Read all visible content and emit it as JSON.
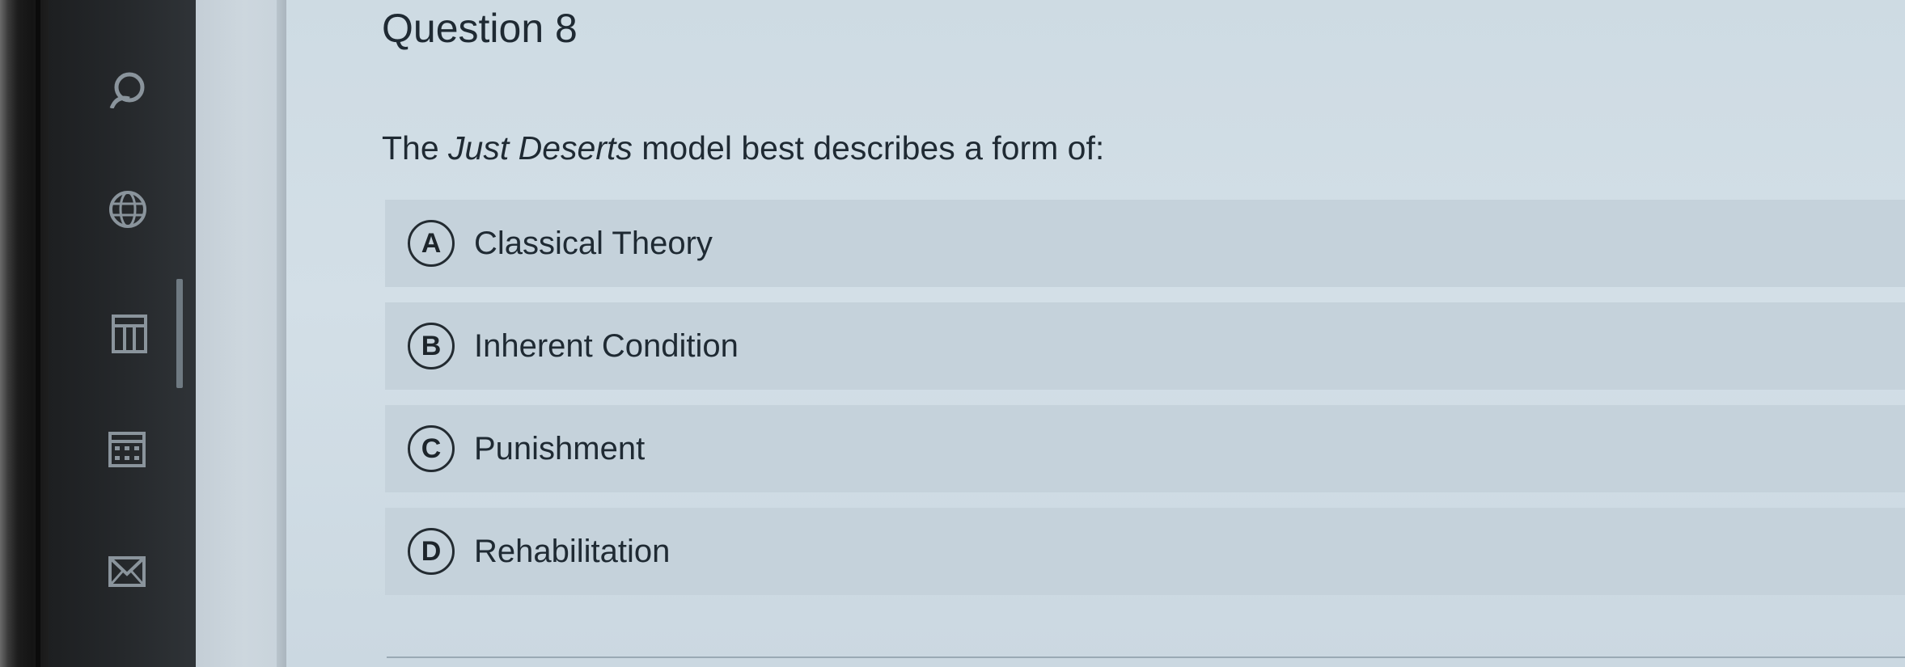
{
  "question": {
    "title": "Question 8",
    "prompt_before": "The ",
    "prompt_italic": "Just Deserts",
    "prompt_after": " model best describes a form of:"
  },
  "answers": [
    {
      "letter": "A",
      "label": "Classical Theory"
    },
    {
      "letter": "B",
      "label": "Inherent Condition"
    },
    {
      "letter": "C",
      "label": "Punishment"
    },
    {
      "letter": "D",
      "label": "Rehabilitation"
    }
  ],
  "nav": {
    "icons": [
      "user-icon",
      "globe-icon",
      "gradebook-icon",
      "calendar-icon",
      "mail-icon"
    ]
  },
  "colors": {
    "content_bg": "#d3dfe7",
    "answer_bg": "#c5d2db",
    "nav_bg": "#25282b",
    "text": "#1f2a33"
  }
}
